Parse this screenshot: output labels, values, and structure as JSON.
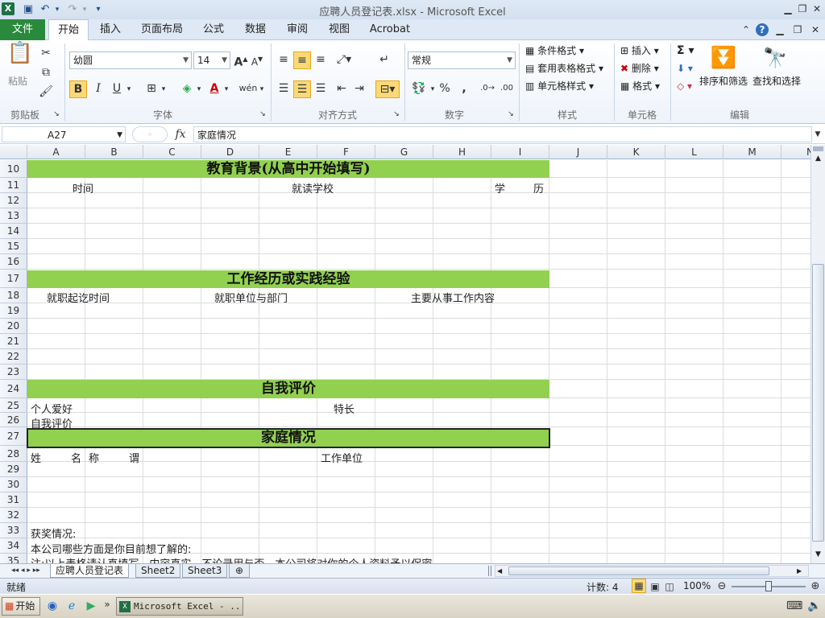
{
  "window": {
    "title": "应聘人员登记表.xlsx  -  Microsoft Excel"
  },
  "qat": {
    "undo_glyph": "↶",
    "redo_glyph": "↷",
    "more_glyph": "▾"
  },
  "tabs": [
    "文件",
    "开始",
    "插入",
    "页面布局",
    "公式",
    "数据",
    "审阅",
    "视图",
    "Acrobat"
  ],
  "ribbon": {
    "clipboard": {
      "paste": "粘贴",
      "label": "剪贴板"
    },
    "font": {
      "name": "幼圆",
      "size": "14",
      "label": "字体",
      "bold": "B",
      "italic": "I",
      "underline": "U",
      "wen": "wén"
    },
    "alignment": {
      "label": "对齐方式"
    },
    "number": {
      "format": "常规",
      "label": "数字",
      "percent": "%",
      "comma": ","
    },
    "styles": {
      "cond": "条件格式",
      "table": "套用表格格式",
      "cell": "单元格样式",
      "label": "样式"
    },
    "cells": {
      "insert": "插入",
      "delete": "删除",
      "format": "格式",
      "label": "单元格"
    },
    "editing": {
      "sort": "排序和筛选",
      "find": "查找和选择",
      "label": "编辑",
      "sigma": "Σ"
    }
  },
  "formula": {
    "namebox": "A27",
    "fx": "fx",
    "content": "家庭情况"
  },
  "columns": [
    "A",
    "B",
    "C",
    "D",
    "E",
    "F",
    "G",
    "H",
    "I",
    "J",
    "K",
    "L",
    "M",
    "N"
  ],
  "rows": [
    "10",
    "11",
    "12",
    "13",
    "14",
    "15",
    "16",
    "17",
    "18",
    "19",
    "20",
    "21",
    "22",
    "23",
    "24",
    "25",
    "26",
    "27",
    "28",
    "29",
    "30",
    "31",
    "32",
    "33",
    "34",
    "35"
  ],
  "sheet": {
    "edu_title": "教育背景(从高中开始填写)",
    "edu_time": "时间",
    "edu_school": "就读学校",
    "edu_degree_1": "学",
    "edu_degree_2": "历",
    "work_title": "工作经历或实践经验",
    "work_time": "就职起讫时间",
    "work_unit": "就职单位与部门",
    "work_content": "主要从事工作内容",
    "self_title": "自我评价",
    "hobby": "个人爱好",
    "specialty": "特长",
    "self_eval": "自我评价",
    "family_title": "家庭情况",
    "name_1": "姓",
    "name_2": "名",
    "title_1": "称",
    "title_2": "谓",
    "employer": "工作单位",
    "awards": "获奖情况:",
    "interest": "本公司哪些方面是你目前想了解的:",
    "note": "注:以上表格请认真填写，内容真实，不论录用与否，本公司将对你的个人资料予以保密"
  },
  "sheets": [
    "应聘人员登记表",
    "Sheet2",
    "Sheet3"
  ],
  "status": {
    "ready": "就绪",
    "count": "计数: 4",
    "zoom": "100%"
  },
  "taskbar": {
    "start": "开始",
    "app": "Microsoft Excel - ..."
  }
}
